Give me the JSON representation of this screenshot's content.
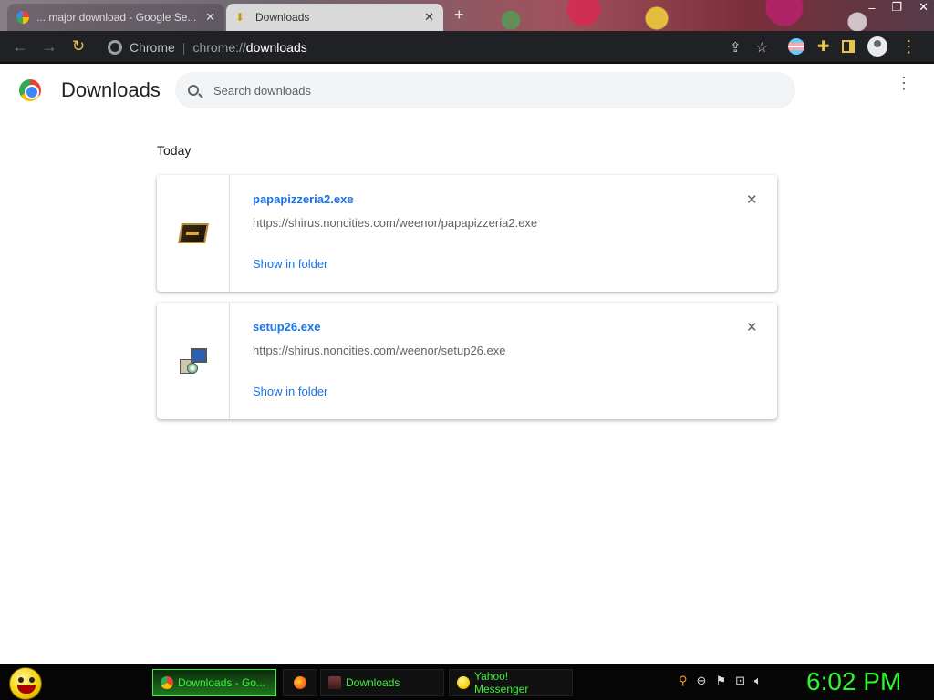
{
  "browser": {
    "tabs": [
      {
        "title": "... major download - Google Se...",
        "active": false
      },
      {
        "title": "Downloads",
        "active": true
      }
    ],
    "new_tab_icon": "plus-icon",
    "window_controls": {
      "minimize": "–",
      "maximize": "❐",
      "close": "✕"
    },
    "toolbar": {
      "back": "←",
      "forward": "→",
      "reload": "↻",
      "site_label": "Chrome",
      "url_prefix": "chrome://",
      "url_main": "downloads",
      "share_icon": "⇪",
      "bookmark_icon": "☆"
    }
  },
  "page": {
    "title": "Downloads",
    "search": {
      "placeholder": "Search downloads"
    },
    "more_menu": "⋮",
    "section_label": "Today",
    "downloads": [
      {
        "file_name": "papapizzeria2.exe",
        "url": "https://shirus.noncities.com/weenor/papapizzeria2.exe",
        "action": "Show in folder",
        "icon": "game-icon"
      },
      {
        "file_name": "setup26.exe",
        "url": "https://shirus.noncities.com/weenor/setup26.exe",
        "action": "Show in folder",
        "icon": "installer-icon"
      }
    ]
  },
  "taskbar": {
    "items": [
      {
        "label": "Downloads - Go...",
        "icon": "chrome-icon",
        "active": true
      },
      {
        "label": "",
        "icon": "firefox-icon",
        "active": false
      },
      {
        "label": "Downloads",
        "icon": "folder-icon",
        "active": false
      },
      {
        "label": "Yahoo! Messenger",
        "icon": "messenger-icon",
        "active": false
      }
    ],
    "clock": "6:02 PM"
  },
  "colors": {
    "link": "#1a73e8",
    "taskbar_text": "#3cf23c",
    "toolbar_bg": "#202124"
  }
}
